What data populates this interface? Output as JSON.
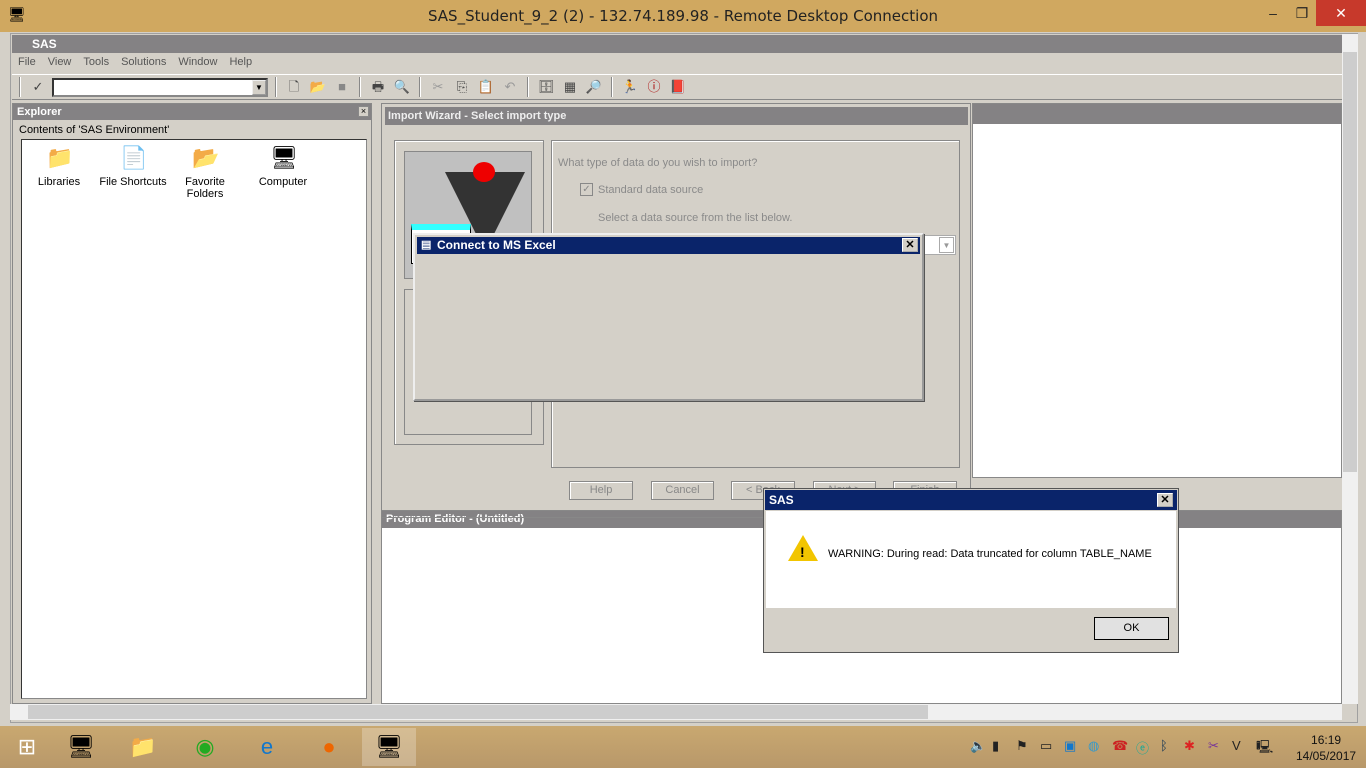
{
  "rdp": {
    "title": "SAS_Student_9_2 (2) - 132.74.189.98 - Remote Desktop Connection",
    "minimize": "–",
    "maximize": "❐",
    "close": "✕"
  },
  "sas": {
    "title": "SAS",
    "menu": [
      "File",
      "View",
      "Tools",
      "Solutions",
      "Window",
      "Help"
    ]
  },
  "toolbar": {
    "check": "✓",
    "icons": [
      "new",
      "open",
      "save",
      "print",
      "print-preview",
      "cut",
      "copy",
      "paste",
      "undo",
      "libraries",
      "explorer",
      "find",
      "run",
      "break",
      "help"
    ]
  },
  "explorer": {
    "title": "Explorer",
    "close": "×",
    "contents": "Contents of 'SAS Environment'",
    "items": [
      {
        "label": "Libraries",
        "icon": "📁"
      },
      {
        "label": "File Shortcuts",
        "icon": "📄"
      },
      {
        "label": "Favorite Folders",
        "icon": "📂"
      },
      {
        "label": "Computer",
        "icon": "🖥"
      }
    ]
  },
  "wizard": {
    "title": "Import Wizard - Select import type",
    "question": "What type of data do you wish to import?",
    "standard": "Standard data source",
    "select_hint": "Select a data source from the list below.",
    "buttons": [
      "Help",
      "Cancel",
      "< Back",
      "Next >",
      "Finish"
    ]
  },
  "editor": {
    "title": "Program Editor - (Untitled)"
  },
  "excel": {
    "title": "Connect to MS Excel",
    "close": "✕"
  },
  "warning": {
    "title": "SAS",
    "close": "✕",
    "message": "WARNING: During read: Data truncated for column TABLE_NAME",
    "ok": "OK"
  },
  "taskbar": {
    "time": "16:19",
    "date": "14/05/2017"
  }
}
